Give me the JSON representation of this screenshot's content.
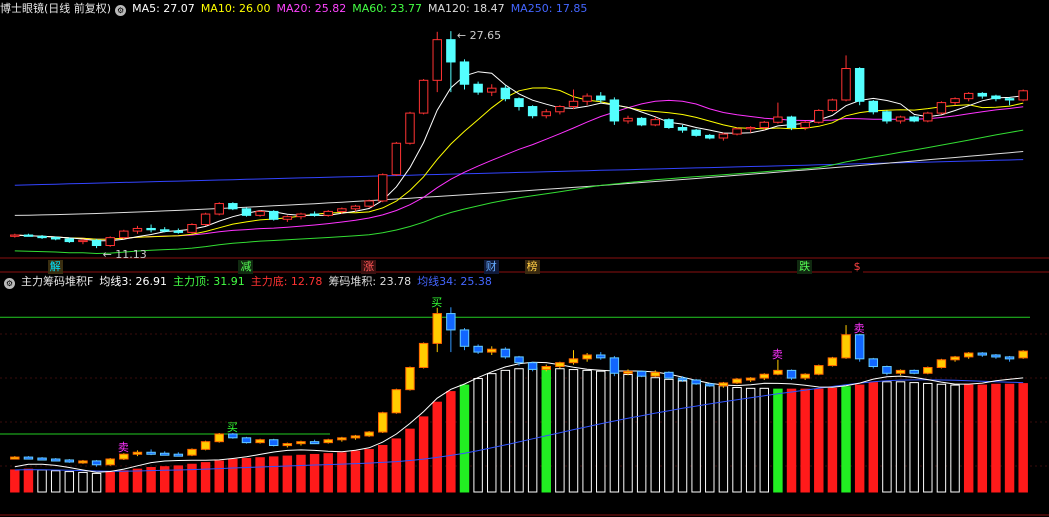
{
  "top_panel": {
    "title": "博士眼镜(日线 前复权)",
    "indicators": [
      {
        "label": "MA5: 27.07",
        "color": "#ffffff"
      },
      {
        "label": "MA10: 26.00",
        "color": "#ffff00"
      },
      {
        "label": "MA20: 25.82",
        "color": "#ff44ff"
      },
      {
        "label": "MA60: 23.77",
        "color": "#44ff44"
      },
      {
        "label": "MA120: 18.47",
        "color": "#dddddd"
      },
      {
        "label": "MA250: 17.85",
        "color": "#4466ff"
      }
    ],
    "high_label": "27.65",
    "low_label": "11.13",
    "events": [
      {
        "text": "解",
        "color": "#00e5ff",
        "bg": "#3a2e10"
      },
      {
        "text": "减",
        "color": "#55ff55",
        "bg": "#102a10"
      },
      {
        "text": "涨",
        "color": "#ff5555",
        "bg": "#3a1010"
      },
      {
        "text": "财",
        "color": "#66aaff",
        "bg": "#101a3a"
      },
      {
        "text": "榜",
        "color": "#ffcc44",
        "bg": "#3a2a10"
      },
      {
        "text": "跌",
        "color": "#55ff55",
        "bg": "#102a10"
      },
      {
        "text": "$",
        "color": "#ff4444",
        "bg": "#000000"
      }
    ]
  },
  "bottom_panel": {
    "title": "主力筹码堆积F",
    "indicators": [
      {
        "label": "均线3: 26.91",
        "color": "#ffffff"
      },
      {
        "label": "主力顶: 31.91",
        "color": "#44ff44"
      },
      {
        "label": "主力底: 12.78",
        "color": "#ff3333"
      },
      {
        "label": "筹码堆积: 23.78",
        "color": "#dddddd"
      },
      {
        "label": "均线34: 25.38",
        "color": "#4466ff"
      }
    ],
    "top_line_value": 31.91,
    "bottom_line_value": 12.78,
    "markers": [
      {
        "text": "买",
        "color": "#33ff33"
      },
      {
        "text": "卖",
        "color": "#ff33ff"
      }
    ]
  },
  "chart_data": [
    {
      "type": "candlestick",
      "ohlc": [
        [
          12.0,
          12.2,
          11.9,
          12.1
        ],
        [
          12.1,
          12.2,
          12.0,
          12.0
        ],
        [
          12.0,
          12.1,
          11.8,
          11.9
        ],
        [
          11.9,
          12.0,
          11.7,
          11.8
        ],
        [
          11.8,
          11.9,
          11.5,
          11.6
        ],
        [
          11.6,
          11.8,
          11.4,
          11.7
        ],
        [
          11.7,
          11.8,
          11.1,
          11.3
        ],
        [
          11.3,
          12.0,
          11.2,
          11.9
        ],
        [
          11.9,
          12.5,
          11.8,
          12.4
        ],
        [
          12.4,
          12.8,
          12.2,
          12.6
        ],
        [
          12.6,
          12.9,
          12.3,
          12.5
        ],
        [
          12.5,
          12.7,
          12.3,
          12.4
        ],
        [
          12.4,
          12.6,
          12.2,
          12.3
        ],
        [
          12.3,
          13.0,
          12.2,
          12.9
        ],
        [
          12.9,
          13.8,
          12.8,
          13.7
        ],
        [
          13.7,
          14.6,
          13.6,
          14.5
        ],
        [
          14.5,
          14.6,
          14.0,
          14.1
        ],
        [
          14.1,
          14.2,
          13.5,
          13.6
        ],
        [
          13.6,
          14.0,
          13.5,
          13.9
        ],
        [
          13.9,
          14.0,
          13.2,
          13.3
        ],
        [
          13.3,
          13.6,
          13.1,
          13.5
        ],
        [
          13.5,
          13.8,
          13.3,
          13.7
        ],
        [
          13.7,
          13.9,
          13.5,
          13.6
        ],
        [
          13.6,
          14.0,
          13.5,
          13.9
        ],
        [
          13.9,
          14.2,
          13.7,
          14.1
        ],
        [
          14.1,
          14.4,
          13.9,
          14.3
        ],
        [
          14.3,
          14.8,
          14.2,
          14.7
        ],
        [
          14.7,
          16.8,
          14.6,
          16.7
        ],
        [
          16.7,
          19.2,
          16.6,
          19.1
        ],
        [
          19.1,
          21.5,
          19.0,
          21.4
        ],
        [
          21.4,
          24.0,
          21.3,
          23.9
        ],
        [
          23.9,
          27.6,
          23.0,
          27.0
        ],
        [
          27.0,
          27.65,
          23.0,
          25.3
        ],
        [
          25.3,
          25.5,
          23.2,
          23.6
        ],
        [
          23.6,
          23.8,
          22.8,
          23.0
        ],
        [
          23.0,
          23.6,
          22.7,
          23.3
        ],
        [
          23.3,
          23.5,
          22.3,
          22.5
        ],
        [
          22.5,
          22.6,
          21.6,
          21.9
        ],
        [
          21.9,
          22.0,
          21.0,
          21.2
        ],
        [
          21.2,
          21.7,
          21.0,
          21.5
        ],
        [
          21.5,
          22.0,
          21.3,
          21.9
        ],
        [
          21.9,
          23.2,
          21.7,
          22.3
        ],
        [
          22.3,
          22.9,
          22.0,
          22.7
        ],
        [
          22.7,
          23.0,
          22.2,
          22.4
        ],
        [
          22.4,
          22.6,
          20.5,
          20.8
        ],
        [
          20.8,
          21.2,
          20.6,
          21.0
        ],
        [
          21.0,
          21.1,
          20.4,
          20.5
        ],
        [
          20.5,
          21.1,
          20.4,
          20.9
        ],
        [
          20.9,
          21.0,
          20.2,
          20.3
        ],
        [
          20.3,
          20.5,
          19.9,
          20.1
        ],
        [
          20.1,
          20.2,
          19.6,
          19.7
        ],
        [
          19.7,
          19.8,
          19.4,
          19.5
        ],
        [
          19.5,
          19.9,
          19.3,
          19.8
        ],
        [
          19.8,
          20.3,
          19.7,
          20.2
        ],
        [
          20.2,
          20.4,
          19.9,
          20.3
        ],
        [
          20.3,
          20.8,
          20.1,
          20.7
        ],
        [
          20.7,
          22.2,
          20.6,
          21.1
        ],
        [
          21.1,
          21.2,
          20.1,
          20.3
        ],
        [
          20.3,
          20.8,
          20.1,
          20.7
        ],
        [
          20.7,
          21.7,
          20.6,
          21.6
        ],
        [
          21.6,
          22.5,
          21.5,
          22.4
        ],
        [
          22.4,
          25.8,
          22.3,
          24.8
        ],
        [
          24.8,
          24.9,
          22.0,
          22.3
        ],
        [
          22.3,
          22.4,
          21.3,
          21.5
        ],
        [
          21.5,
          21.6,
          20.6,
          20.8
        ],
        [
          20.8,
          21.2,
          20.6,
          21.1
        ],
        [
          21.1,
          21.2,
          20.7,
          20.8
        ],
        [
          20.8,
          21.5,
          20.7,
          21.4
        ],
        [
          21.4,
          22.3,
          21.3,
          22.2
        ],
        [
          22.2,
          22.6,
          22.0,
          22.5
        ],
        [
          22.5,
          23.0,
          22.3,
          22.9
        ],
        [
          22.9,
          23.0,
          22.5,
          22.7
        ],
        [
          22.7,
          22.8,
          22.3,
          22.5
        ],
        [
          22.5,
          22.6,
          22.0,
          22.4
        ],
        [
          22.4,
          23.2,
          22.3,
          23.1
        ]
      ],
      "ylim": [
        10.5,
        28.5
      ]
    },
    {
      "type": "bar",
      "values": [
        13.2,
        13.3,
        13.2,
        13.1,
        13.0,
        12.9,
        12.78,
        12.9,
        13.1,
        13.3,
        13.5,
        13.6,
        13.7,
        13.9,
        14.1,
        14.3,
        14.5,
        14.6,
        14.7,
        14.8,
        14.9,
        15.0,
        15.1,
        15.2,
        15.3,
        15.5,
        15.7,
        16.2,
        17.0,
        18.2,
        19.7,
        21.5,
        22.8,
        23.6,
        24.4,
        25.0,
        25.4,
        25.6,
        25.7,
        25.7,
        25.6,
        25.5,
        25.4,
        25.3,
        25.1,
        24.9,
        24.7,
        24.5,
        24.3,
        24.1,
        23.9,
        23.7,
        23.5,
        23.3,
        23.2,
        23.2,
        23.1,
        23.1,
        23.1,
        23.1,
        23.2,
        23.4,
        23.6,
        23.9,
        24.0,
        24.0,
        23.9,
        23.8,
        23.7,
        23.6,
        23.6,
        23.6,
        23.7,
        23.7,
        23.78
      ],
      "up_flags": [
        1,
        1,
        0,
        0,
        0,
        0,
        0,
        1,
        1,
        1,
        1,
        1,
        1,
        1,
        1,
        1,
        1,
        1,
        1,
        1,
        1,
        1,
        1,
        1,
        1,
        1,
        1,
        1,
        1,
        1,
        1,
        1,
        1,
        0,
        0,
        0,
        0,
        0,
        0,
        0,
        0,
        0,
        0,
        0,
        0,
        0,
        0,
        0,
        0,
        0,
        0,
        0,
        0,
        0,
        0,
        0,
        1,
        1,
        1,
        1,
        1,
        1,
        1,
        1,
        0,
        0,
        0,
        0,
        0,
        0,
        1,
        1,
        1,
        1,
        1
      ],
      "green_indices": [
        33,
        39,
        56,
        61
      ],
      "ylim": [
        10.5,
        35
      ]
    }
  ]
}
